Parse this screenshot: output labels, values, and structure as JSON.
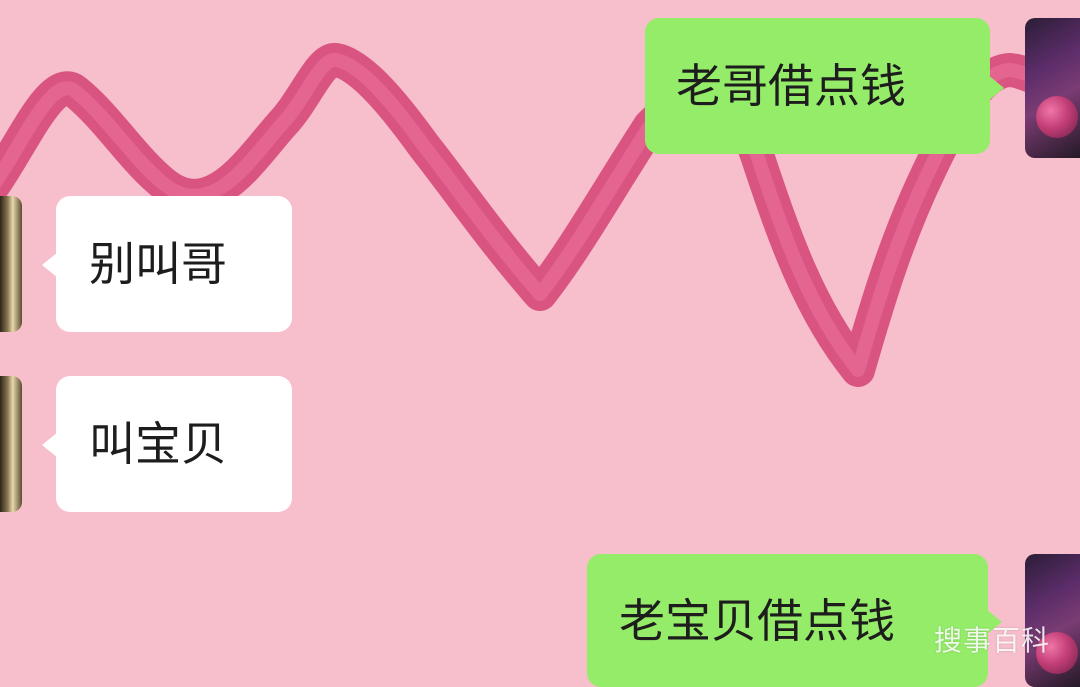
{
  "conversation": {
    "messages": [
      {
        "direction": "sent",
        "text": "老哥借点钱"
      },
      {
        "direction": "received",
        "text": "别叫哥"
      },
      {
        "direction": "received",
        "text": "叫宝贝"
      },
      {
        "direction": "sent",
        "text": "老宝贝借点钱"
      }
    ]
  },
  "watermark": {
    "text": "搜事百科"
  },
  "colors": {
    "background": "#f7bfcb",
    "sent_bubble": "#95ec69",
    "received_bubble": "#ffffff",
    "scribble": "#d94f7f"
  },
  "icons": {
    "sender_avatar": "profile-picture",
    "receiver_avatar": "profile-picture"
  }
}
